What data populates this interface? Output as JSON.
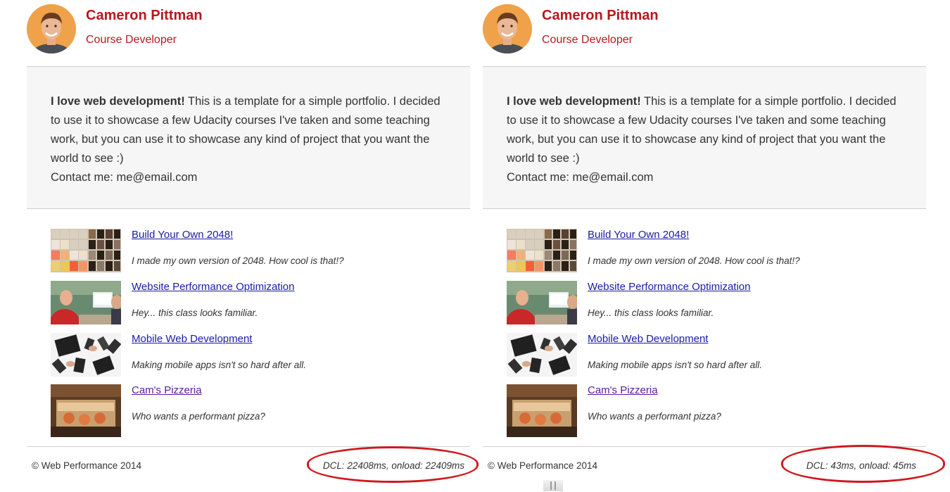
{
  "profile": {
    "name": "Cameron Pittman",
    "role": "Course Developer"
  },
  "intro": {
    "bold": "I love web development!",
    "text": " This is a template for a simple portfolio. I decided to use it to showcase a few Udacity courses I've taken and some teaching work, but you can use it to showcase any kind of project that you want the world to see :)",
    "contact": "Contact me: me@email.com"
  },
  "projects": [
    {
      "title": "Build Your Own 2048",
      "suffix": "!",
      "desc": "I made my own version of 2048. How cool is that!?"
    },
    {
      "title": "Website Performance Optimization",
      "desc": "Hey... this class looks familiar."
    },
    {
      "title": "Mobile Web Development",
      "desc": "Making mobile apps isn't so hard after all."
    },
    {
      "title": "Cam's Pizzeria",
      "desc": "Who wants a performant pizza?"
    }
  ],
  "footer": {
    "copyright": "© Web Performance 2014",
    "perf_left": "DCL: 22408ms, onload: 22409ms",
    "perf_right": "DCL: 43ms, onload: 45ms"
  },
  "colors": {
    "accent": "#b5191c",
    "annotation": "#d0191e",
    "link": "#1a1aa6",
    "visited_link": "#5b1a9e"
  }
}
